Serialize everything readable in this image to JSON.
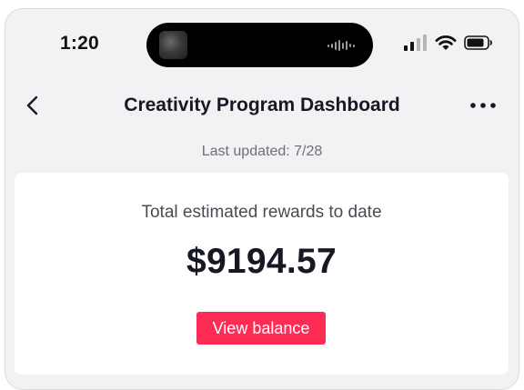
{
  "status_bar": {
    "time": "1:20",
    "icons": [
      "cellular-signal-icon",
      "wifi-icon",
      "battery-icon"
    ]
  },
  "nav": {
    "title": "Creativity Program Dashboard",
    "back_icon": "chevron-left-icon",
    "more_icon": "more-horizontal-icon"
  },
  "last_updated": "Last updated: 7/28",
  "rewards_card": {
    "label": "Total estimated rewards to date",
    "amount": "$9194.57",
    "button_label": "View balance"
  },
  "colors": {
    "accent": "#fe2c55",
    "background": "#f2f2f4",
    "card": "#ffffff",
    "text_primary": "#161823",
    "text_secondary": "#6e6f75"
  }
}
